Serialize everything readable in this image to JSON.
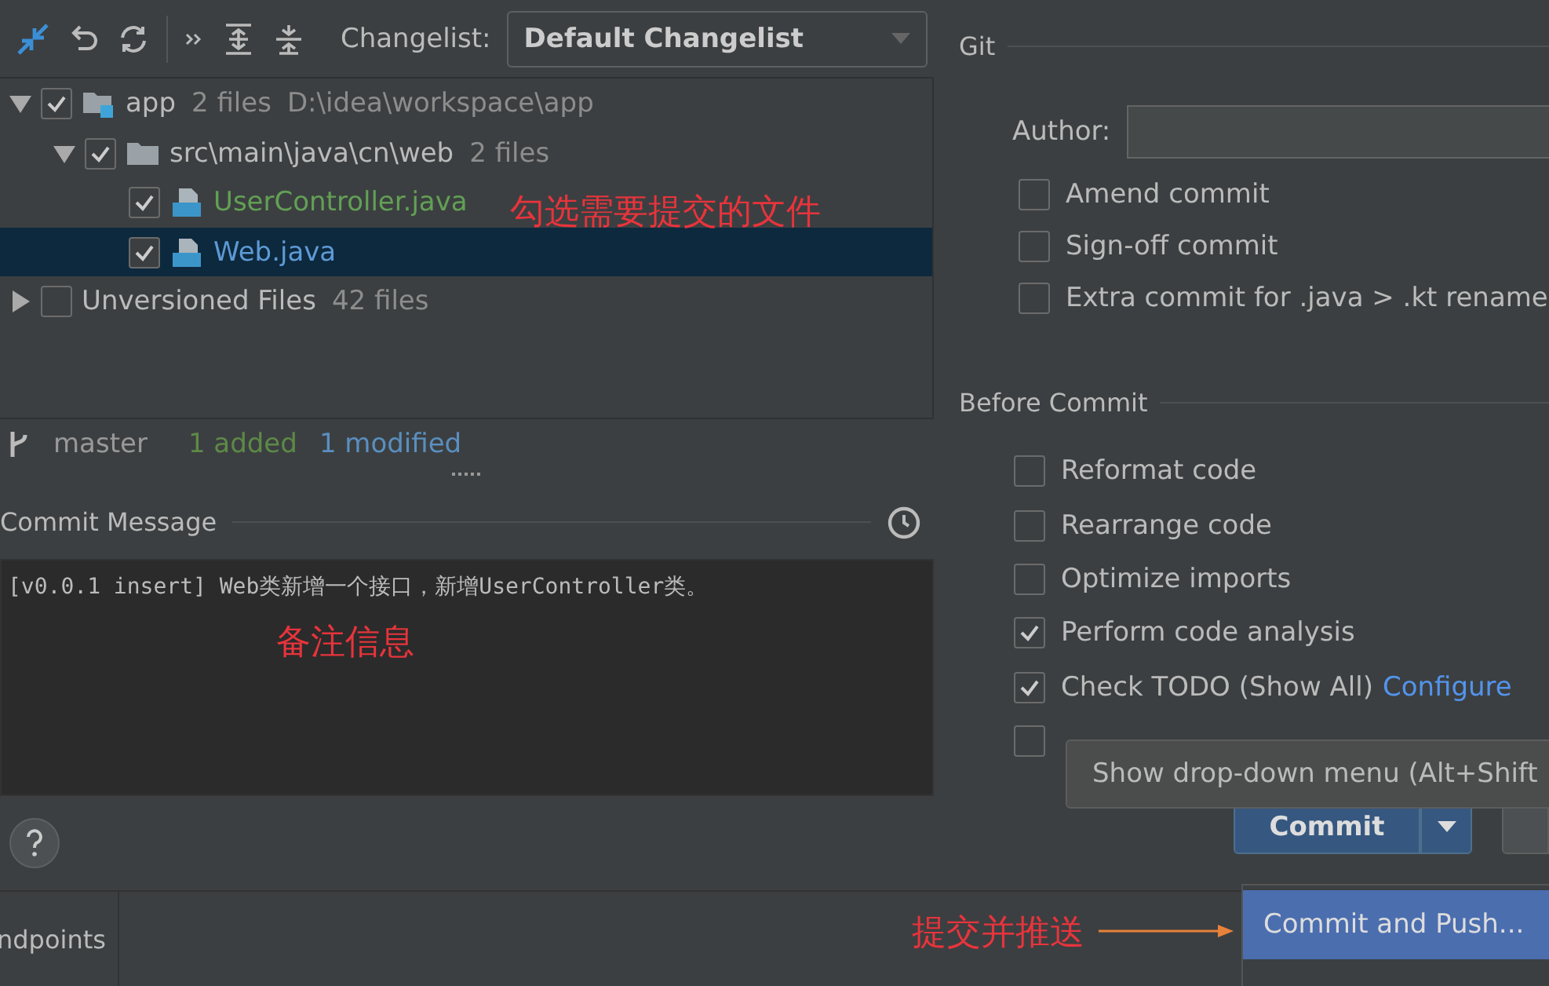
{
  "toolbar": {
    "changelist_label": "Changelist:",
    "changelist_value": "Default Changelist"
  },
  "tree": [
    {
      "label": "app",
      "count": "2 files",
      "path": "D:\\idea\\workspace\\app",
      "kind": "module",
      "checked": true,
      "expanded": true,
      "selected": false,
      "children": [
        {
          "label": "src\\main\\java\\cn\\web",
          "count": "2 files",
          "kind": "folder",
          "checked": true,
          "expanded": true,
          "selected": false,
          "children": [
            {
              "label": "UserController.java",
              "kind": "added",
              "checked": true,
              "selected": false
            },
            {
              "label": "Web.java",
              "kind": "modified",
              "checked": true,
              "selected": true
            }
          ]
        }
      ]
    },
    {
      "label": "Unversioned Files",
      "count": "42 files",
      "kind": "group",
      "checked": false,
      "expanded": false,
      "selected": false
    }
  ],
  "status": {
    "branch": "master",
    "added": "1 added",
    "modified": "1 modified"
  },
  "commit_message": {
    "title": "Commit Message",
    "text": "[v0.0.1 insert] Web类新增一个接口，新增UserController类。"
  },
  "git": {
    "title": "Git",
    "author_label": "Author:",
    "checkboxes": [
      {
        "label": "Amend commit",
        "checked": false
      },
      {
        "label": "Sign-off commit",
        "checked": false
      },
      {
        "label": "Extra commit for .java > .kt rename",
        "checked": false
      }
    ]
  },
  "before_commit": {
    "title": "Before Commit",
    "checkboxes": [
      {
        "label": "Reformat code",
        "checked": false
      },
      {
        "label": "Rearrange code",
        "checked": false
      },
      {
        "label": "Optimize imports",
        "checked": false
      },
      {
        "label": "Perform code analysis",
        "checked": true
      },
      {
        "label": "Check TODO (Show All)",
        "link": "Configure",
        "checked": true
      },
      {
        "checked": false
      }
    ]
  },
  "tooltip": "Show drop-down menu (Alt+Shift",
  "commit_button": "Commit",
  "menu_item": "Commit and Push...",
  "bottom_tab": "ndpoints",
  "annotations": [
    {
      "kind": "files",
      "text": "勾选需要提交的文件"
    },
    {
      "kind": "message",
      "text": "备注信息"
    },
    {
      "kind": "push",
      "text": "提交并推送"
    }
  ]
}
